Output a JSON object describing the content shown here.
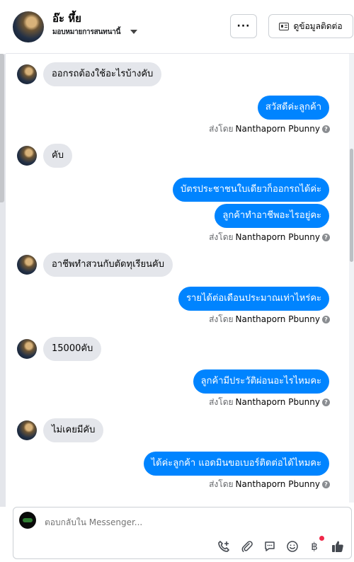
{
  "header": {
    "name": "อ๊ะ หึ้ย",
    "subtitle": "มอบหมายการสนทนานี้",
    "more_label": "···",
    "contact_label": "ดูข้อมูลติดต่อ"
  },
  "messages": [
    {
      "dir": "in",
      "text": "ออกรถต้องใช้อะไรบ้างคับ"
    },
    {
      "dir": "out",
      "text": "สวัสดีค่ะลูกค้า"
    },
    {
      "dir": "sent_by"
    },
    {
      "dir": "in",
      "text": "คับ"
    },
    {
      "dir": "out",
      "text": "บัตรประชาชนใบเดียวก็ออกรถได้ค่ะ"
    },
    {
      "dir": "out",
      "text": "ลูกค้าทำอาชีพอะไรอยู่คะ"
    },
    {
      "dir": "sent_by"
    },
    {
      "dir": "in",
      "text": "อาชีพทำสวนกับตัดทุเรียนคับ"
    },
    {
      "dir": "out",
      "text": "รายได้ต่อเดือนประมาณเท่าไหร่คะ"
    },
    {
      "dir": "sent_by"
    },
    {
      "dir": "in",
      "text": "15000คับ"
    },
    {
      "dir": "out",
      "text": "ลูกค้ามีประวัติผ่อนอะไรไหมคะ"
    },
    {
      "dir": "sent_by"
    },
    {
      "dir": "in",
      "text": "ไม่เคยมีคับ"
    },
    {
      "dir": "out",
      "text": "ได้ค่ะลูกค้า แอดมินขอเบอร์ติดต่อได้ไหมคะ"
    },
    {
      "dir": "sent_by"
    }
  ],
  "sent_by": {
    "prefix": "ส่งโดย",
    "sender": "Nanthaporn Pbunny"
  },
  "composer": {
    "placeholder": "ตอบกลับใน Messenger..."
  },
  "icons": {
    "call": "phone-plus-icon",
    "attach": "paperclip-icon",
    "saved_replies": "chat-bubble-icon",
    "emoji": "smiley-icon",
    "payment": "baht-icon",
    "like": "thumbs-up-icon"
  },
  "colors": {
    "outgoing_bubble": "#0084ff",
    "incoming_bubble": "#e4e6eb",
    "meta_text": "#65676b",
    "notification_dot": "#f02849"
  }
}
